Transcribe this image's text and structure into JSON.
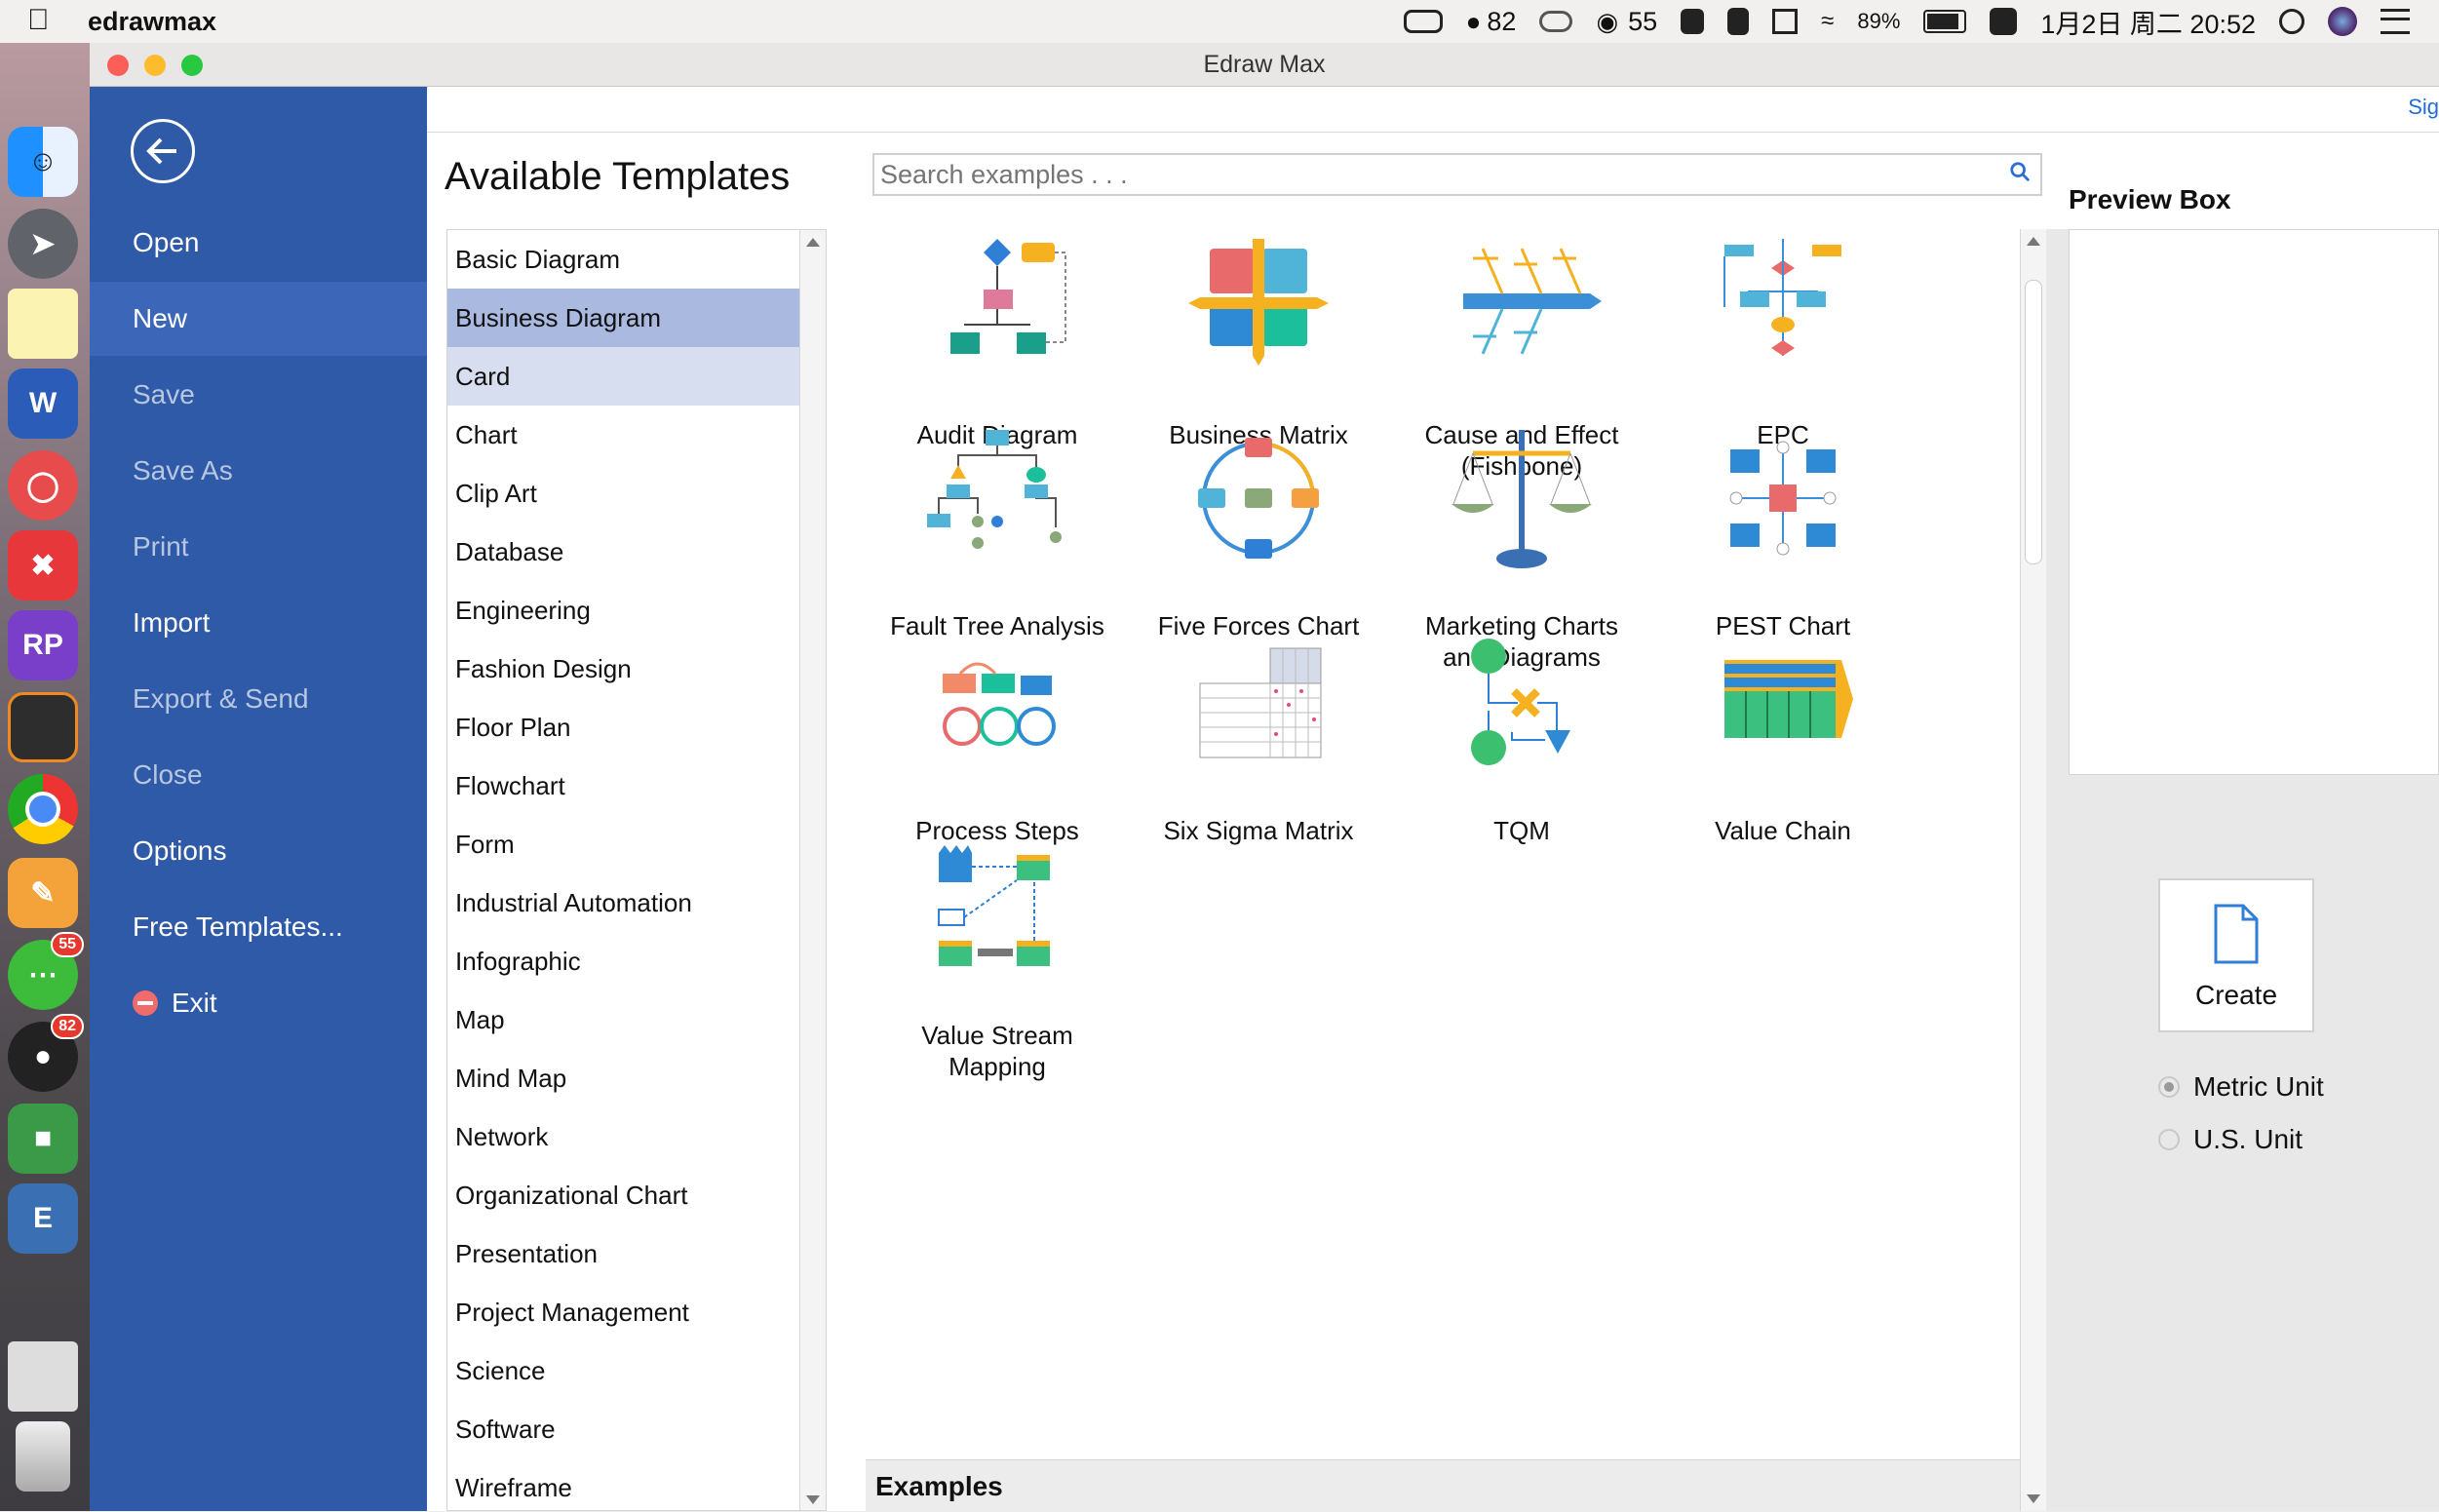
{
  "menubar": {
    "app_name": "edrawmax",
    "qq_count": "82",
    "wechat_count": "55",
    "battery": "89%",
    "datetime": "1月2日 周二  20:52"
  },
  "dock": {
    "word_letter": "W",
    "rp_letter": "RP",
    "wechat_badge": "55",
    "qq_badge": "82"
  },
  "window": {
    "title": "Edraw Max"
  },
  "sidebar": {
    "items": [
      {
        "label": "Open",
        "state": "normal"
      },
      {
        "label": "New",
        "state": "active"
      },
      {
        "label": "Save",
        "state": "dim"
      },
      {
        "label": "Save As",
        "state": "dim"
      },
      {
        "label": "Print",
        "state": "dim"
      },
      {
        "label": "Import",
        "state": "normal"
      },
      {
        "label": "Export & Send",
        "state": "dim"
      },
      {
        "label": "Close",
        "state": "dim"
      },
      {
        "label": "Options",
        "state": "normal"
      },
      {
        "label": "Free Templates...",
        "state": "normal"
      },
      {
        "label": "Exit",
        "state": "normal"
      }
    ]
  },
  "main": {
    "sign_in": "Sig",
    "title": "Available Templates",
    "search_placeholder": "Search examples . . .",
    "categories": [
      "Basic Diagram",
      "Business Diagram",
      "Card",
      "Chart",
      "Clip Art",
      "Database",
      "Engineering",
      "Fashion Design",
      "Floor Plan",
      "Flowchart",
      "Form",
      "Industrial Automation",
      "Infographic",
      "Map",
      "Mind Map",
      "Network",
      "Organizational Chart",
      "Presentation",
      "Project Management",
      "Science",
      "Software",
      "Wireframe"
    ],
    "selected_category": "Business Diagram",
    "hovered_category": "Card",
    "templates": [
      {
        "line1": "Audit Diagram",
        "line2": ""
      },
      {
        "line1": "Business Matrix",
        "line2": ""
      },
      {
        "line1": "Cause and Effect",
        "line2": "(Fishbone)"
      },
      {
        "line1": "EPC",
        "line2": ""
      },
      {
        "line1": "Fault Tree Analysis",
        "line2": ""
      },
      {
        "line1": "Five Forces Chart",
        "line2": ""
      },
      {
        "line1": "Marketing Charts",
        "line2": "and Diagrams"
      },
      {
        "line1": "PEST Chart",
        "line2": ""
      },
      {
        "line1": "Process Steps",
        "line2": ""
      },
      {
        "line1": "Six Sigma Matrix",
        "line2": ""
      },
      {
        "line1": "TQM",
        "line2": ""
      },
      {
        "line1": "Value Chain",
        "line2": ""
      },
      {
        "line1": "Value Stream",
        "line2": "Mapping"
      }
    ],
    "examples_label": "Examples"
  },
  "preview": {
    "title": "Preview Box",
    "create_label": "Create",
    "units": [
      {
        "label": "Metric Unit",
        "selected": true
      },
      {
        "label": "U.S. Unit",
        "selected": false
      }
    ]
  }
}
